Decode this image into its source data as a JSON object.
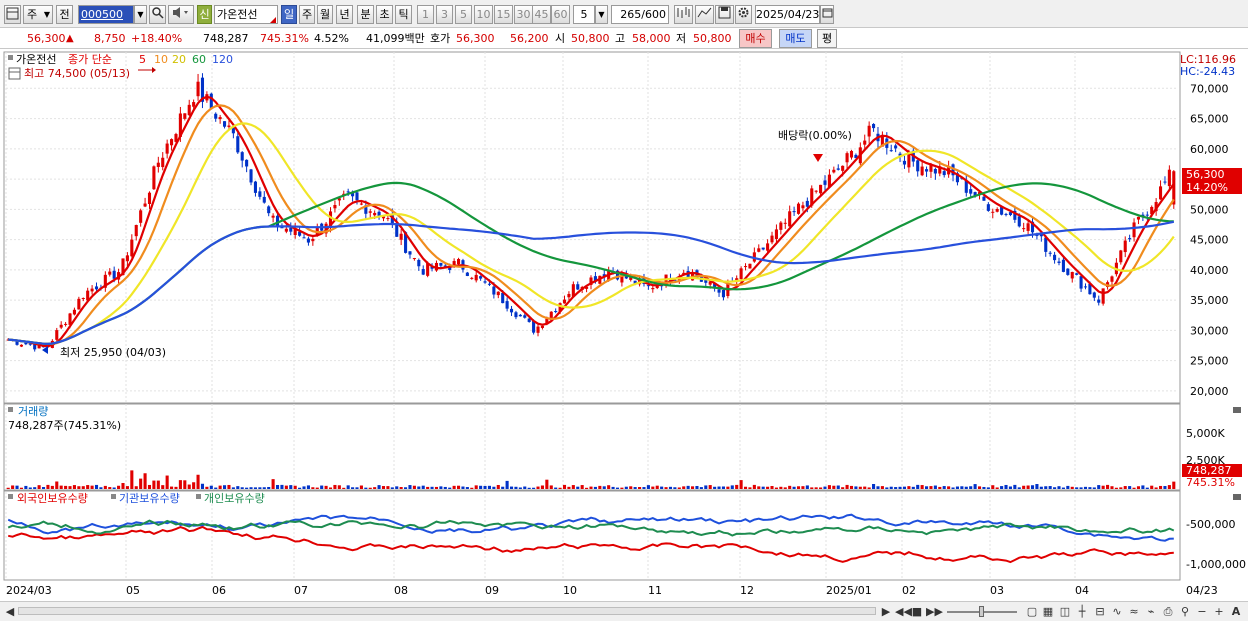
{
  "toolbar": {
    "market": "주",
    "period_kind": "전",
    "code": "000500",
    "name": "가온전선",
    "shin": "신",
    "periods": [
      "일",
      "주",
      "월",
      "년",
      "분",
      "초",
      "틱"
    ],
    "active_period": "일",
    "minutes": [
      "1",
      "3",
      "5",
      "10",
      "15",
      "30",
      "45",
      "60"
    ],
    "minute_select": "5",
    "count": "265",
    "count_total": "/600",
    "date": "2025/04/23"
  },
  "info": {
    "price": "56,300",
    "change_arrow": "▲",
    "change": "8,750",
    "change_rate": "+18.40%",
    "volume": "748,287",
    "volume_rate": "745.31%",
    "turnover": "4.52%",
    "amount": "41,099백만",
    "bid_label": "호가",
    "ask": "56,300",
    "bid": "56,200",
    "open_label": "시",
    "open": "50,800",
    "high_label": "고",
    "high": "58,000",
    "low_label": "저",
    "low": "50,800",
    "buy": "매수",
    "sell": "매도",
    "eval": "평"
  },
  "price_panel": {
    "title": "가온전선",
    "ma_label": "종가 단순",
    "ma_periods": [
      "5",
      "10",
      "20",
      "60",
      "120"
    ],
    "ma_colors": [
      "#e00000",
      "#f08c1e",
      "#f0e628",
      "#14963c",
      "#2850dc"
    ],
    "high_note": "최고 74,500 (05/13)",
    "low_note": "최저 25,950 (04/03)",
    "dividend_note": "배당락(0.00%)",
    "lc": "LC:116.96",
    "hc": "HC:-24.43",
    "y_ticks": [
      "70,000",
      "65,000",
      "60,000",
      "55,000",
      "50,000",
      "45,000",
      "40,000",
      "35,000",
      "30,000",
      "25,000",
      "20,000"
    ],
    "last_price": "56,300",
    "last_rate": "14.20%"
  },
  "volume_panel": {
    "title": "거래량",
    "value_note": "748,287주(745.31%)",
    "y_ticks": [
      "5,000K",
      "2,500K"
    ],
    "last_value": "748,287",
    "last_rate": "745.31%"
  },
  "holdings_panel": {
    "legend": [
      "외국인보유수량",
      "기관보유수량",
      "개인보유수량"
    ],
    "colors": [
      "#e00000",
      "#1e50dc",
      "#1e8c50"
    ],
    "y_ticks": [
      "-500,000",
      "-1,000,000"
    ]
  },
  "x_axis": [
    "2024/03",
    "05",
    "06",
    "07",
    "08",
    "09",
    "10",
    "11",
    "12",
    "2025/01",
    "02",
    "03",
    "04"
  ],
  "x_axis_right": "04/23",
  "chart_data": {
    "type": "line",
    "title": "가온전선",
    "ylim": [
      18000,
      76000
    ],
    "dates": [
      "2024-03-27",
      "2024-04-03",
      "2024-04-15",
      "2024-04-25",
      "2024-05-03",
      "2024-05-13",
      "2024-05-24",
      "2024-06-05",
      "2024-06-20",
      "2024-07-02",
      "2024-07-16",
      "2024-08-01",
      "2024-08-14",
      "2024-08-28",
      "2024-09-10",
      "2024-09-25",
      "2024-10-08",
      "2024-10-22",
      "2024-11-05",
      "2024-11-20",
      "2024-12-04",
      "2024-12-18",
      "2025-01-03",
      "2025-01-17",
      "2025-02-03",
      "2025-02-17",
      "2025-03-04",
      "2025-03-18",
      "2025-04-01",
      "2025-04-09",
      "2025-04-16",
      "2025-04-23"
    ],
    "close_approx": [
      28500,
      27000,
      36000,
      40000,
      58000,
      70000,
      62000,
      48000,
      45000,
      52000,
      49000,
      40000,
      41000,
      36000,
      30000,
      37000,
      40000,
      37000,
      40000,
      36000,
      43000,
      50000,
      56000,
      63000,
      58000,
      56000,
      51000,
      48000,
      41000,
      35000,
      47500,
      56300
    ],
    "high": {
      "value": 74500,
      "date": "05/13"
    },
    "low": {
      "value": 25950,
      "date": "04/03"
    },
    "last": {
      "close": 56300,
      "open": 50800,
      "high": 58000,
      "low": 50800,
      "volume": 748287
    }
  }
}
